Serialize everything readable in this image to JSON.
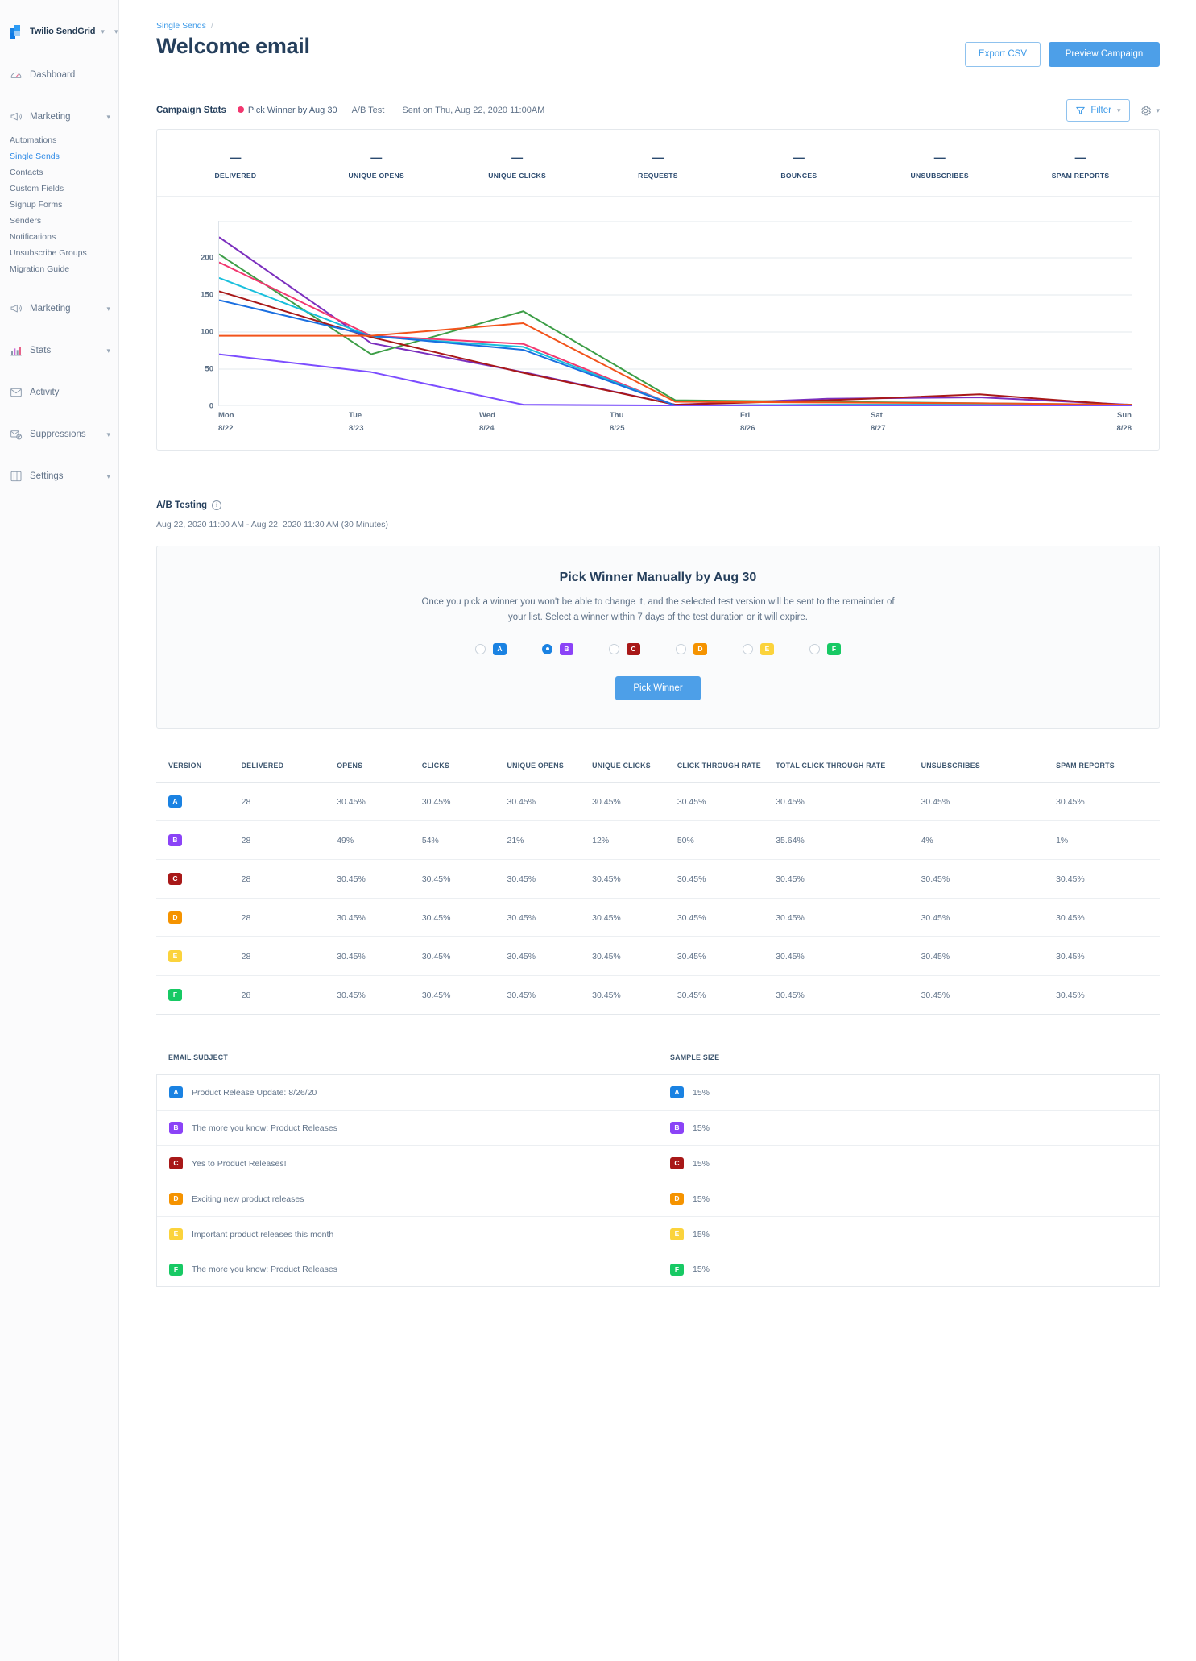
{
  "sidebar": {
    "brand": {
      "name": "Twilio SendGrid",
      "logo_icon": "sendgrid-logo-icon",
      "chevron_icon": "chevron-down-icon"
    },
    "groups": [
      {
        "label": "Dashboard",
        "icon": "gauge-icon",
        "has_chevron": false,
        "items": []
      },
      {
        "label": "Marketing",
        "icon": "megaphone-icon",
        "has_chevron": true,
        "items": [
          {
            "label": "Automations",
            "active": false
          },
          {
            "label": "Single Sends",
            "active": true
          },
          {
            "label": "Contacts",
            "active": false
          },
          {
            "label": "Custom Fields",
            "active": false
          },
          {
            "label": "Signup Forms",
            "active": false
          },
          {
            "label": "Senders",
            "active": false
          },
          {
            "label": "Notifications",
            "active": false
          },
          {
            "label": "Unsubscribe Groups",
            "active": false
          },
          {
            "label": "Migration Guide",
            "active": false
          }
        ]
      },
      {
        "label": "Marketing",
        "icon": "megaphone-icon",
        "has_chevron": true,
        "items": []
      },
      {
        "label": "Stats",
        "icon": "bar-chart-icon",
        "has_chevron": true,
        "items": []
      },
      {
        "label": "Activity",
        "icon": "envelope-icon",
        "has_chevron": false,
        "items": []
      },
      {
        "label": "Suppressions",
        "icon": "mail-block-icon",
        "has_chevron": true,
        "items": []
      },
      {
        "label": "Settings",
        "icon": "sliders-icon",
        "has_chevron": true,
        "items": []
      }
    ]
  },
  "header": {
    "breadcrumb_link": "Single Sends",
    "breadcrumb_separator": "/",
    "title": "Welcome email",
    "export_label": "Export CSV",
    "preview_label": "Preview Campaign"
  },
  "campaign_stats": {
    "title": "Campaign Stats",
    "status_dot_color": "#f2376f",
    "status": "Pick Winner by Aug 30",
    "test_type": "A/B Test",
    "sent_on": "Sent on Thu, Aug 22, 2020 11:00AM",
    "filter_label": "Filter",
    "filter_icon": "funnel-icon",
    "gear_icon": "gear-icon",
    "chevron_icon": "chevron-down-icon",
    "metrics": [
      {
        "label": "DELIVERED",
        "value": "—"
      },
      {
        "label": "UNIQUE OPENS",
        "value": "—"
      },
      {
        "label": "UNIQUE CLICKS",
        "value": "—"
      },
      {
        "label": "REQUESTS",
        "value": "—"
      },
      {
        "label": "BOUNCES",
        "value": "—"
      },
      {
        "label": "UNSUBSCRIBES",
        "value": "—"
      },
      {
        "label": "SPAM REPORTS",
        "value": "—"
      }
    ]
  },
  "chart_data": {
    "type": "line",
    "title": "",
    "xlabel": "",
    "ylabel": "",
    "ylim": [
      0,
      250
    ],
    "yticks": [
      0,
      50,
      100,
      150,
      200
    ],
    "grid": true,
    "legend": "none",
    "x": [
      "Mon 8/22",
      "Tue 8/23",
      "Wed 8/24",
      "Thu 8/25",
      "Fri 8/26",
      "Sat 8/27",
      "Sun 8/28"
    ],
    "x_days": [
      "Mon",
      "Tue",
      "Wed",
      "Thu",
      "Fri",
      "Sat",
      "Sun"
    ],
    "x_dates": [
      "8/22",
      "8/23",
      "8/24",
      "8/25",
      "8/26",
      "8/27",
      "8/28"
    ],
    "series": [
      {
        "name": "purple-dark",
        "color": "#7b2fbe",
        "values": [
          228,
          85,
          46,
          2,
          10,
          12,
          2
        ]
      },
      {
        "name": "green",
        "color": "#3d9e47",
        "values": [
          205,
          70,
          128,
          8,
          6,
          4,
          2
        ]
      },
      {
        "name": "pink",
        "color": "#f2376f",
        "values": [
          194,
          95,
          84,
          1,
          2,
          2,
          1
        ]
      },
      {
        "name": "cyan",
        "color": "#18bfdc",
        "values": [
          173,
          94,
          80,
          1,
          2,
          2,
          1
        ]
      },
      {
        "name": "dark-red",
        "color": "#a81818",
        "values": [
          155,
          93,
          45,
          2,
          8,
          16,
          1
        ]
      },
      {
        "name": "blue",
        "color": "#1a6fe0",
        "values": [
          143,
          95,
          76,
          1,
          1,
          1,
          1
        ]
      },
      {
        "name": "orange",
        "color": "#f2531b",
        "values": [
          95,
          95,
          112,
          6,
          5,
          4,
          2
        ]
      },
      {
        "name": "violet",
        "color": "#7c4dff",
        "values": [
          70,
          46,
          2,
          1,
          1,
          1,
          1
        ]
      }
    ]
  },
  "ab_testing": {
    "title": "A/B Testing",
    "info_icon": "info-icon",
    "range": "Aug 22, 2020 11:00 AM - Aug 22, 2020 11:30 AM (30 Minutes)",
    "panel": {
      "title": "Pick Winner Manually by Aug 30",
      "description": "Once you pick a winner you won't be able to change it, and the selected test version will be sent to the remainder of your list. Select a winner within 7 days of the test duration or it will expire.",
      "options": [
        {
          "label": "A",
          "color": "#1a82e2",
          "selected": false
        },
        {
          "label": "B",
          "color": "#8b43f7",
          "selected": true
        },
        {
          "label": "C",
          "color": "#a81818",
          "selected": false
        },
        {
          "label": "D",
          "color": "#f59300",
          "selected": false
        },
        {
          "label": "E",
          "color": "#fbd33c",
          "selected": false
        },
        {
          "label": "F",
          "color": "#17c964",
          "selected": false
        }
      ],
      "button_label": "Pick Winner"
    }
  },
  "version_table": {
    "columns": [
      "VERSION",
      "DELIVERED",
      "OPENS",
      "CLICKS",
      "UNIQUE OPENS",
      "UNIQUE CLICKS",
      "CLICK THROUGH RATE",
      "TOTAL CLICK THROUGH RATE",
      "UNSUBSCRIBES",
      "SPAM REPORTS"
    ],
    "rows": [
      {
        "version": "A",
        "color": "#1a82e2",
        "cells": [
          "28",
          "30.45%",
          "30.45%",
          "30.45%",
          "30.45%",
          "30.45%",
          "30.45%",
          "30.45%",
          "30.45%"
        ]
      },
      {
        "version": "B",
        "color": "#8b43f7",
        "cells": [
          "28",
          "49%",
          "54%",
          "21%",
          "12%",
          "50%",
          "35.64%",
          "4%",
          "1%"
        ]
      },
      {
        "version": "C",
        "color": "#a81818",
        "cells": [
          "28",
          "30.45%",
          "30.45%",
          "30.45%",
          "30.45%",
          "30.45%",
          "30.45%",
          "30.45%",
          "30.45%"
        ]
      },
      {
        "version": "D",
        "color": "#f59300",
        "cells": [
          "28",
          "30.45%",
          "30.45%",
          "30.45%",
          "30.45%",
          "30.45%",
          "30.45%",
          "30.45%",
          "30.45%"
        ]
      },
      {
        "version": "E",
        "color": "#fbd33c",
        "cells": [
          "28",
          "30.45%",
          "30.45%",
          "30.45%",
          "30.45%",
          "30.45%",
          "30.45%",
          "30.45%",
          "30.45%"
        ]
      },
      {
        "version": "F",
        "color": "#17c964",
        "cells": [
          "28",
          "30.45%",
          "30.45%",
          "30.45%",
          "30.45%",
          "30.45%",
          "30.45%",
          "30.45%",
          "30.45%"
        ]
      }
    ]
  },
  "subject_table": {
    "subject_header": "EMAIL SUBJECT",
    "sample_header": "SAMPLE SIZE",
    "rows": [
      {
        "version": "A",
        "color": "#1a82e2",
        "subject": "Product Release Update: 8/26/20",
        "sample": "15%"
      },
      {
        "version": "B",
        "color": "#8b43f7",
        "subject": "The more you know: Product Releases",
        "sample": "15%"
      },
      {
        "version": "C",
        "color": "#a81818",
        "subject": "Yes to Product Releases!",
        "sample": "15%"
      },
      {
        "version": "D",
        "color": "#f59300",
        "subject": "Exciting new product releases",
        "sample": "15%"
      },
      {
        "version": "E",
        "color": "#fbd33c",
        "subject": "Important product releases this month",
        "sample": "15%"
      },
      {
        "version": "F",
        "color": "#17c964",
        "subject": "The more you know: Product Releases",
        "sample": "15%"
      }
    ]
  }
}
